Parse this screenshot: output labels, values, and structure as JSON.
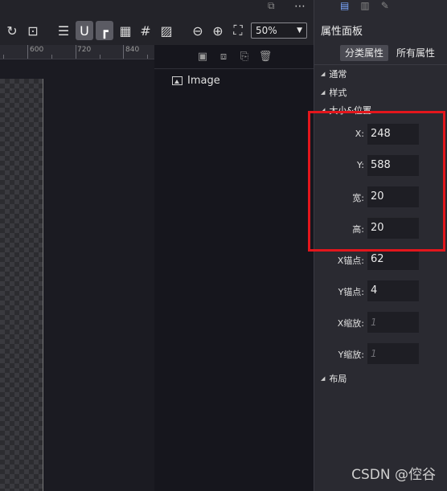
{
  "toolbar": {
    "zoom_value": "50%",
    "icons": [
      "refresh-icon",
      "lock-image-icon",
      "database-icon",
      "magnet-icon",
      "snap-corner-icon",
      "grid-icon",
      "hash-grid-icon",
      "image-check-icon",
      "zoom-out-icon",
      "zoom-in-icon",
      "fit-screen-icon"
    ]
  },
  "ruler": {
    "labels": [
      "600",
      "720",
      "840"
    ]
  },
  "layers": {
    "items": [
      {
        "label": "Image",
        "icon": "image-icon"
      }
    ]
  },
  "properties": {
    "title": "属性面板",
    "tabs": [
      {
        "label": "分类属性",
        "active": true
      },
      {
        "label": "所有属性",
        "active": false
      }
    ],
    "sections": {
      "general": "通常",
      "style": "样式",
      "size_position": "大小&位置",
      "layout": "布局"
    },
    "fields": {
      "x": {
        "label": "X:",
        "value": "248"
      },
      "y": {
        "label": "Y:",
        "value": "588"
      },
      "width": {
        "label": "宽:",
        "value": "20"
      },
      "height": {
        "label": "高:",
        "value": "20"
      },
      "anchor_x": {
        "label": "X锚点:",
        "value": "62"
      },
      "anchor_y": {
        "label": "Y锚点:",
        "value": "4"
      },
      "scale_x": {
        "label": "X缩放:",
        "placeholder": "1"
      },
      "scale_y": {
        "label": "Y缩放:",
        "placeholder": "1"
      }
    }
  },
  "watermark": "CSDN @倥谷",
  "colors": {
    "highlight_box": "#e3161c",
    "panel_bg": "#2a2a31",
    "input_bg": "#1e1e24"
  }
}
